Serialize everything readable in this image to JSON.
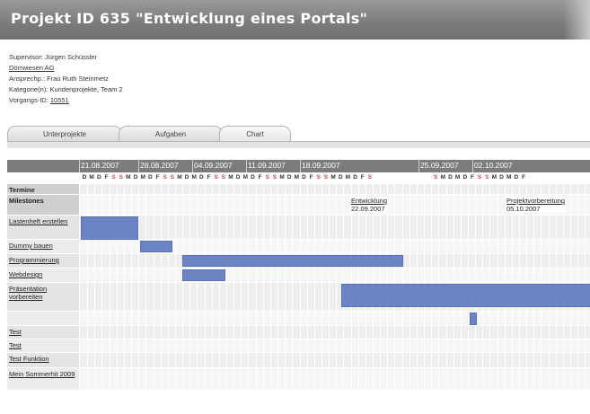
{
  "page": {
    "title": "Projekt ID 635 \"Entwicklung eines Portals\""
  },
  "info": {
    "supervisor_label": "Supervisor:",
    "supervisor": "Jürgen Schüssler",
    "company": "Dörrwiesen AG",
    "contact_label": "Ansprechp.:",
    "contact": "Frau Ruth Steinmetz",
    "categories_label": "Kategorie(n):",
    "categories": "Kundenprojekte, Team 2",
    "process_label": "Vorgangs-ID:",
    "process_id": "10551"
  },
  "tabs": [
    "Unterprojekte",
    "Aufgaben",
    "Chart"
  ],
  "gantt": {
    "weeks": [
      "21.08.2007",
      "28.08.2007",
      "04.09.2007",
      "11.09.2007",
      "18.09.2007",
      "25.09.2007",
      "02.10.2007"
    ],
    "weekdays": [
      "D",
      "M",
      "D",
      "F",
      "S",
      "S",
      "M",
      "D",
      "M",
      "D",
      "F",
      "S",
      "S",
      "M",
      "D",
      "M",
      "D",
      "F",
      "S",
      "S",
      "M",
      "D",
      "M",
      "D",
      "F",
      "S",
      "S",
      "M",
      "D",
      "M",
      "D",
      "F",
      "S",
      "S",
      "M",
      "D",
      "M",
      "D",
      "F",
      "S",
      "",
      "",
      "",
      "",
      "",
      "",
      "",
      "",
      "S",
      "M",
      "D",
      "M",
      "D",
      "F",
      "S",
      "S",
      "M",
      "D",
      "M",
      "D",
      "F"
    ],
    "rows": [
      {
        "label": "Termine",
        "type": "head"
      },
      {
        "label": "Milestones",
        "type": "head"
      },
      {
        "label": "Lastenheft erstellen",
        "type": "task"
      },
      {
        "label": "Dummy bauen",
        "type": "task"
      },
      {
        "label": "Programmierung",
        "type": "task"
      },
      {
        "label": "Webdesign",
        "type": "task"
      },
      {
        "label": "Präsentation vorbereiten",
        "type": "task"
      },
      {
        "label": "",
        "type": "task"
      },
      {
        "label": "Test",
        "type": "task"
      },
      {
        "label": "Test",
        "type": "task"
      },
      {
        "label": "Test Funktion",
        "type": "task"
      },
      {
        "label": "Mein Sommerhit 2009",
        "type": "task"
      }
    ],
    "milestones": [
      {
        "name": "Entwicklung",
        "date": "22.09.2007"
      },
      {
        "name": "Projektvorbereitung",
        "date": "05.10.2007"
      }
    ]
  }
}
